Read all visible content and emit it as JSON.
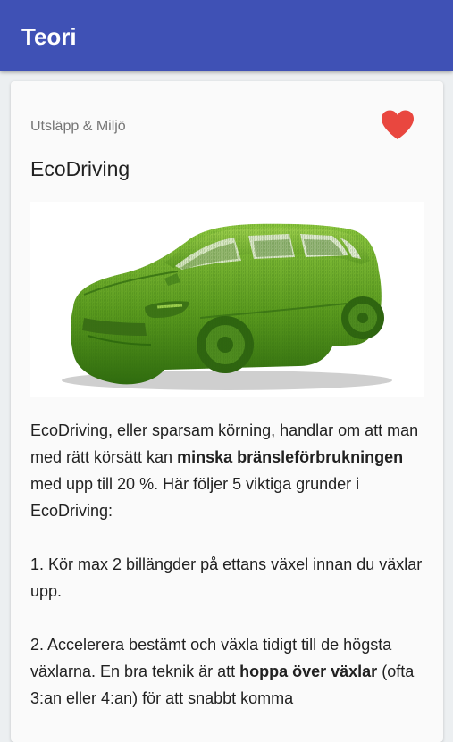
{
  "appbar": {
    "title": "Teori"
  },
  "article": {
    "category": "Utsläpp & Miljö",
    "title": "EcoDriving",
    "favorite_color": "#e9473f",
    "image": {
      "subject": "green grass-covered car"
    },
    "intro": {
      "t1": "EcoDriving, eller sparsam körning, handlar om att man med rätt körsätt kan ",
      "b1": "minska bränsleförbrukningen",
      "t2": " med upp till 20 %. Här följer 5 viktiga grunder i EcoDriving:"
    },
    "point1": "1. Kör max 2 billängder på ettans växel innan du växlar upp.",
    "point2": {
      "t1": "2. Accelerera bestämt och växla tidigt till de högsta växlarna. En bra teknik är att ",
      "b1": "hoppa över växlar",
      "t2": " (ofta 3:an eller 4:an) för att snabbt komma"
    }
  },
  "colors": {
    "appbar": "#3f51b5",
    "card": "#fafafa",
    "background": "#eceff1"
  }
}
